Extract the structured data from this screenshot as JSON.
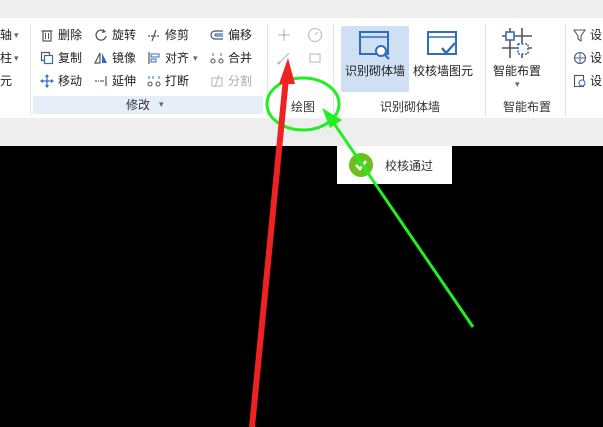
{
  "left_partial": {
    "row1": "轴",
    "row2": "柱",
    "row3": "元"
  },
  "modify_group": {
    "title": "修改",
    "items": [
      {
        "label": "删除",
        "icon": "trash-icon"
      },
      {
        "label": "旋转",
        "icon": "rotate-icon"
      },
      {
        "label": "修剪",
        "icon": "trim-icon"
      },
      {
        "label": "偏移",
        "icon": "offset-icon"
      },
      {
        "label": "复制",
        "icon": "copy-icon"
      },
      {
        "label": "镜像",
        "icon": "mirror-icon"
      },
      {
        "label": "对齐",
        "icon": "align-icon"
      },
      {
        "label": "合并",
        "icon": "merge-icon"
      },
      {
        "label": "移动",
        "icon": "move-icon"
      },
      {
        "label": "延伸",
        "icon": "extend-icon"
      },
      {
        "label": "打断",
        "icon": "break-icon"
      },
      {
        "label": "分割",
        "icon": "split-icon",
        "disabled": true
      }
    ]
  },
  "draw_group": {
    "title": "绘图"
  },
  "recognize_group": {
    "title": "识别砌体墙",
    "buttons": [
      {
        "label": "识别砌体墙",
        "icon": "recognize-wall-icon",
        "selected": true
      },
      {
        "label": "校核墙图元",
        "icon": "check-wall-icon"
      }
    ]
  },
  "smart_group": {
    "title": "智能布置",
    "button": {
      "label": "智能布置",
      "icon": "smart-layout-icon"
    }
  },
  "right_partial": {
    "row1": "设",
    "row2": "设",
    "row3": "设"
  },
  "toast": {
    "text": "校核通过"
  },
  "colors": {
    "selected_bg": "#cfe0f5",
    "group_bar": "#e6eef9",
    "toast_check": "#6cc01c",
    "annotation_green": "#22ee22",
    "annotation_red": "#ee2222",
    "canvas": "#000000"
  }
}
